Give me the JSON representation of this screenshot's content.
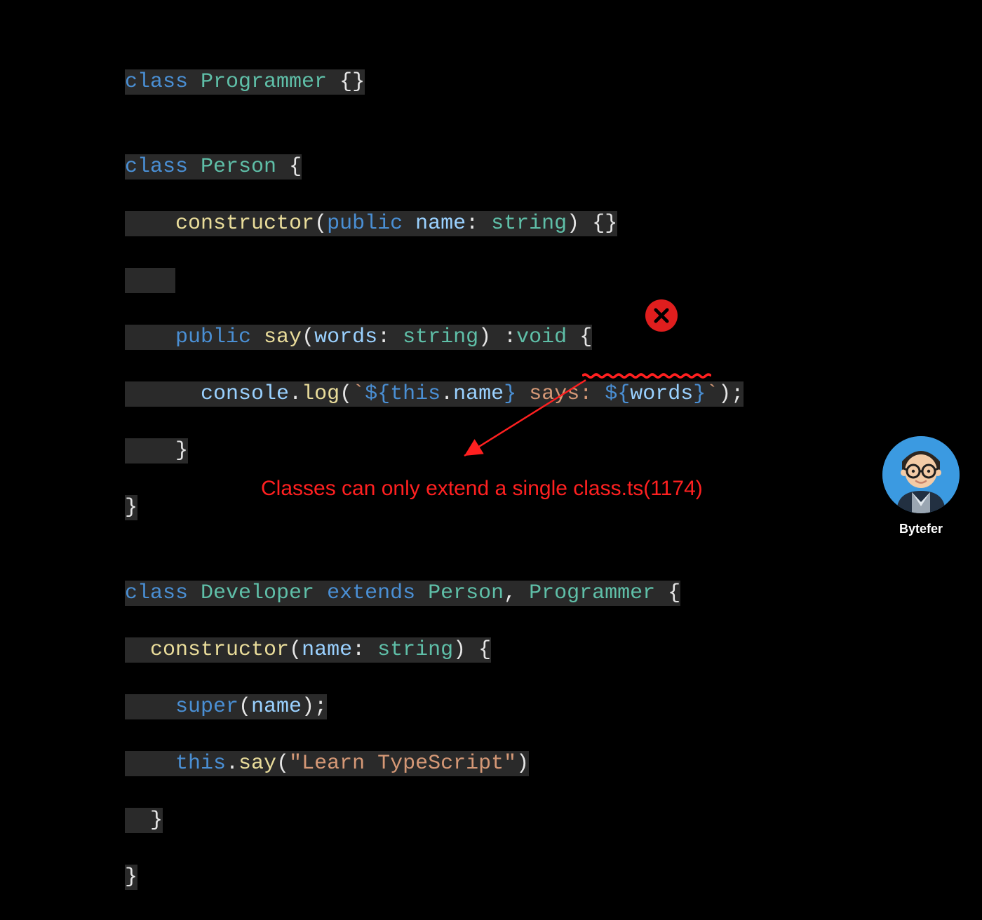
{
  "code": {
    "l1": {
      "class": "class ",
      "name": "Programmer",
      "rest": " {}"
    },
    "l2": "",
    "l3": {
      "class": "class ",
      "name": "Person",
      "rest": " {"
    },
    "l4": {
      "indent": "    ",
      "ctor": "constructor",
      "paren1": "(",
      "public": "public ",
      "param": "name",
      "colon": ": ",
      "type": "string",
      "paren2": ")",
      "rest": " {}"
    },
    "l5": {
      "indent": "    "
    },
    "l6": {
      "indent": "    ",
      "public": "public ",
      "fn": "say",
      "paren1": "(",
      "param": "words",
      "colon": ": ",
      "type": "string",
      "paren2": ")",
      "colon2": " :",
      "void": "void",
      "brace": " {"
    },
    "l7": {
      "indent": "      ",
      "console": "console",
      "dot": ".",
      "log": "log",
      "paren1": "(",
      "bt1": "`",
      "tpl1": "${",
      "this": "this",
      "dot2": ".",
      "name": "name",
      "tpl1e": "}",
      "mid": " says: ",
      "tpl2": "${",
      "words": "words",
      "tpl2e": "}",
      "bt2": "`",
      "paren2": ");"
    },
    "l8": {
      "indent": "    ",
      "brace": "}"
    },
    "l9": {
      "brace": "}"
    },
    "l10": "",
    "l11": {
      "class": "class ",
      "name": "Developer",
      "extends": " extends ",
      "p1": "Person",
      "comma": ", ",
      "p2": "Programmer",
      "brace": " {"
    },
    "l12": {
      "indent": "  ",
      "ctor": "constructor",
      "paren1": "(",
      "param": "name",
      "colon": ": ",
      "type": "string",
      "paren2": ")",
      "brace": " {"
    },
    "l13": {
      "indent": "    ",
      "super": "super",
      "paren1": "(",
      "param": "name",
      "paren2": ");"
    },
    "l14": {
      "indent": "    ",
      "this": "this",
      "dot": ".",
      "say": "say",
      "paren1": "(",
      "str": "\"Learn TypeScript\"",
      "paren2": ")"
    },
    "l15": {
      "indent": "  ",
      "brace": "}"
    },
    "l16": {
      "brace": "}"
    }
  },
  "error": {
    "message": "Classes can only extend a single class.ts(1174)"
  },
  "author": {
    "name": "Bytefer"
  }
}
